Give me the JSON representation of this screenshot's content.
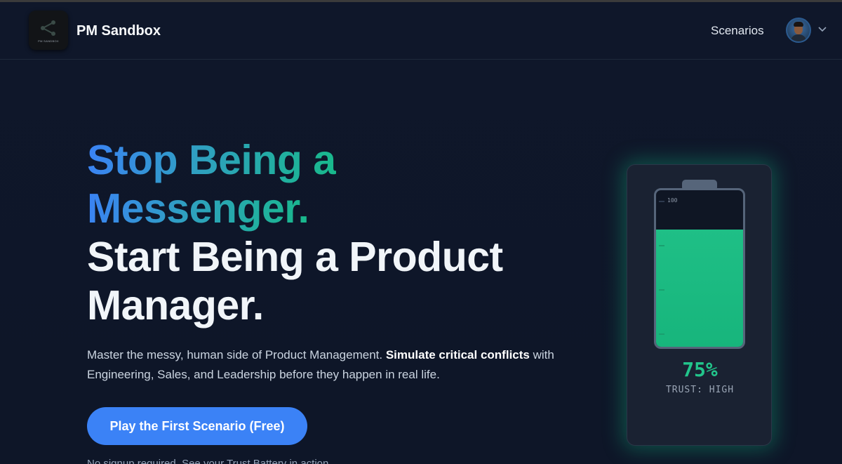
{
  "header": {
    "logo_caption": "PM SANDBOX",
    "brand": "PM Sandbox",
    "nav_link": "Scenarios",
    "user_menu_icon": "chevron-down-icon"
  },
  "hero": {
    "line1": "Stop Being a",
    "line2": "Messenger.",
    "line3": "Start Being a Product",
    "line4": "Manager.",
    "lead_part1": "Master the messy, human side of Product Management. ",
    "lead_bold": "Simulate critical conflicts",
    "lead_part2": " with Engineering, Sales, and Leadership before they happen in real life.",
    "cta_label": "Play the First Scenario (Free)",
    "note": "No signup required. See your Trust Battery in action."
  },
  "trust_battery": {
    "level": 0.75,
    "top_tick_label": "100",
    "percent_text": "75%",
    "status_text": "TRUST: HIGH"
  },
  "colors": {
    "background": "#0f172a",
    "accent_blue": "#3b82f6",
    "accent_green": "#22c58b",
    "battery_fill": "#1fbf86"
  }
}
